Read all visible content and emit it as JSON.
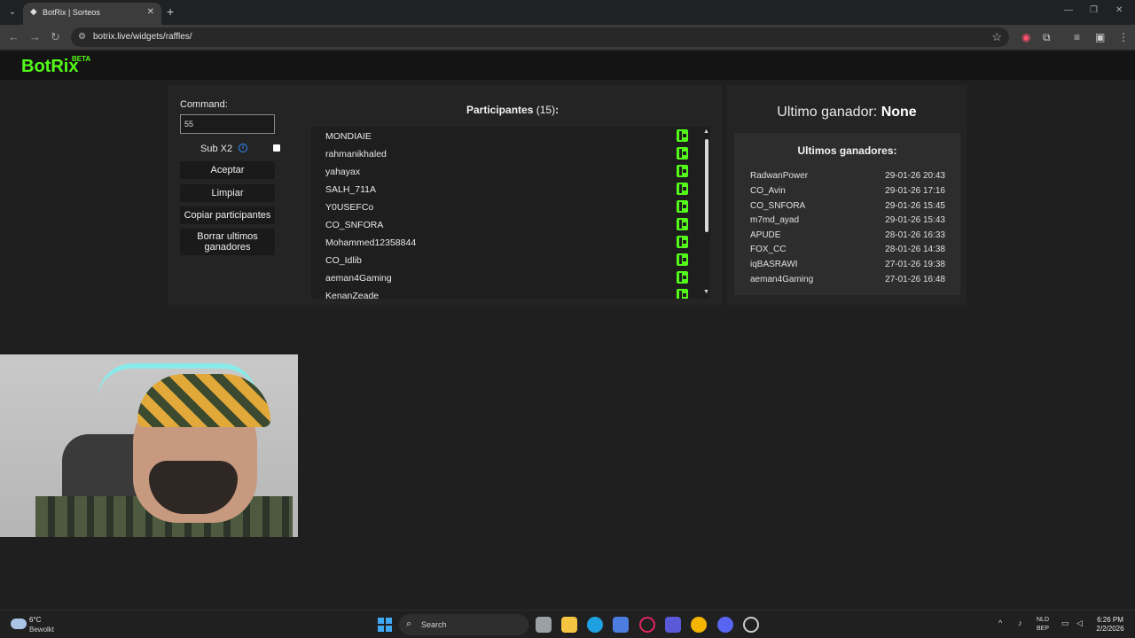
{
  "browser": {
    "tab_title": "BotRix | Sorteos",
    "url": "botrix.live/widgets/raffles/"
  },
  "site": {
    "logo": "BotRix",
    "logo_badge": "BETA"
  },
  "raffle": {
    "command_label": "Command:",
    "command_value": "55",
    "sub_x2_label": "Sub X2",
    "sub_x2_checked": false,
    "buttons": {
      "accept": "Aceptar",
      "clear": "Limpiar",
      "copy": "Copiar participantes",
      "clear_winners": "Borrar ultimos ganadores"
    },
    "participants_title": "Participantes",
    "participants_count": "(15)",
    "participants_colon": ":",
    "participants": [
      "MONDIAIE",
      "rahmanikhaled",
      "yahayax",
      "SALH_711A",
      "Y0USEFCo",
      "CO_SNFORA",
      "Mohammed12358844",
      "CO_Idlib",
      "aeman4Gaming",
      "KenanZeade"
    ]
  },
  "winners": {
    "last_winner_label": "Ultimo ganador:",
    "last_winner_value": "None",
    "list_title": "Ultimos ganadores:",
    "list": [
      {
        "name": "RadwanPower",
        "date": "29-01-26 20:43"
      },
      {
        "name": "CO_Avin",
        "date": "29-01-26 17:16"
      },
      {
        "name": "CO_SNFORA",
        "date": "29-01-26 15:45"
      },
      {
        "name": "m7md_ayad",
        "date": "29-01-26 15:43"
      },
      {
        "name": "APUDE",
        "date": "28-01-26 16:33"
      },
      {
        "name": "FOX_CC",
        "date": "28-01-26 14:38"
      },
      {
        "name": "iqBASRAWI",
        "date": "27-01-26 19:38"
      },
      {
        "name": "aeman4Gaming",
        "date": "27-01-26 16:48"
      }
    ]
  },
  "taskbar": {
    "weather_temp": "6°C",
    "weather_desc": "Bewolkt",
    "search_label": "Search",
    "lang_1": "NLD",
    "lang_2": "BEP",
    "time": "6:26 PM",
    "date": "2/2/2026"
  },
  "colors": {
    "brand_green": "#53fc18",
    "panel_bg": "#242424",
    "page_bg": "#1f1f1f",
    "info_blue": "#2f8cff"
  }
}
